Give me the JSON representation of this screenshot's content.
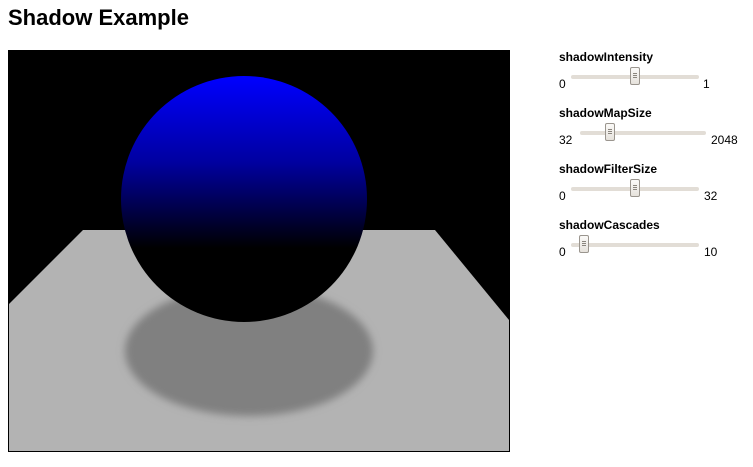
{
  "page": {
    "title": "Shadow Example"
  },
  "scene": {
    "background": "#000000",
    "sphere_color": "#0000ff",
    "plane_color": "#b3b3b3",
    "shadow_color": "#808080"
  },
  "controls": [
    {
      "label": "shadowIntensity",
      "min": "0",
      "max": "1",
      "value": 0.5
    },
    {
      "label": "shadowMapSize",
      "min": "32",
      "max": "2048",
      "value": 512
    },
    {
      "label": "shadowFilterSize",
      "min": "0",
      "max": "32",
      "value": 16
    },
    {
      "label": "shadowCascades",
      "min": "0",
      "max": "10",
      "value": 1
    }
  ]
}
